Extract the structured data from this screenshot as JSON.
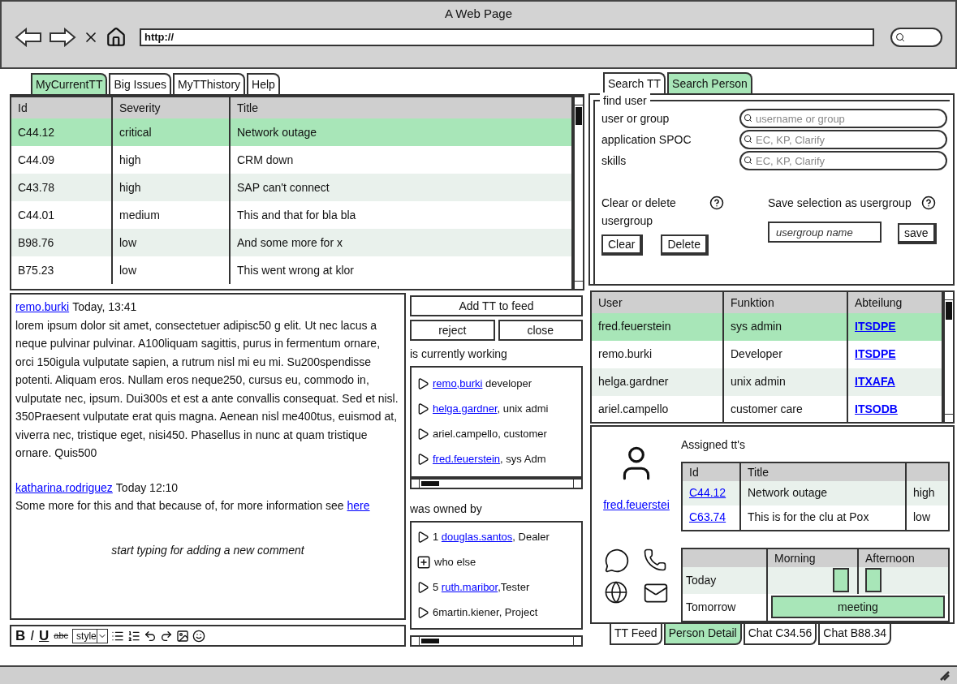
{
  "window": {
    "title": "A Web Page",
    "url": "http://"
  },
  "left_tabs": [
    {
      "label": "MyCurrentTT",
      "selected": true
    },
    {
      "label": "Big Issues",
      "selected": false
    },
    {
      "label": "MyTThistory",
      "selected": false
    },
    {
      "label": "Help",
      "selected": false
    }
  ],
  "tickets": {
    "columns": [
      "Id",
      "Severity",
      "Title"
    ],
    "rows": [
      {
        "cells": [
          "C44.12",
          "critical",
          "Network outage"
        ],
        "selected": true
      },
      {
        "cells": [
          "C44.09",
          "high",
          "CRM down"
        ],
        "selected": false
      },
      {
        "cells": [
          "C43.78",
          "high",
          "SAP can't connect"
        ],
        "selected": false
      },
      {
        "cells": [
          "C44.01",
          "medium",
          "This and that for bla bla"
        ],
        "selected": false
      },
      {
        "cells": [
          "B98.76",
          "low",
          "And some more for x"
        ],
        "selected": false
      },
      {
        "cells": [
          "B75.23",
          "low",
          "This went wrong at klor"
        ],
        "selected": false
      }
    ]
  },
  "feed": {
    "posts": [
      {
        "author": "remo.burki",
        "time": "Today, 13:41",
        "body": "lorem ipsum dolor sit amet, consectetuer adipisc50 g elit. Ut nec lacus a neque pulvinar pulvinar. A100liquam sagittis, purus in fermentum ornare, orci 150igula vulputate sapien, a rutrum nisl mi eu mi. Su200spendisse potenti. Aliquam eros. Nullam eros neque250, cursus eu, commodo in, vulputate nec, ipsum. Dui300s et est a ante convallis consequat. Sed et nisl. 350Praesent vulputate erat quis magna. Aenean nisl me400tus, euismod at, viverra nec, tristique eget, nisi450. Phasellus in nunc at quam tristique ornare. Quis500"
      },
      {
        "author": "katharina.rodriguez",
        "time": "Today 12:10",
        "body": "Some more for this and that because of, for more information see ",
        "link": "here"
      }
    ],
    "compose_placeholder": "start typing for adding a new comment",
    "toolbar": [
      {
        "kind": "bold",
        "label": "B"
      },
      {
        "kind": "italic",
        "label": "I"
      },
      {
        "kind": "underline",
        "label": "U"
      },
      {
        "kind": "strike",
        "label": "abc"
      },
      {
        "kind": "select",
        "label": "style"
      }
    ]
  },
  "actions": {
    "add": "Add TT to feed",
    "buttons": [
      "reject",
      "close"
    ]
  },
  "working": {
    "label": "is currently working",
    "items": [
      {
        "link": "remo,burki",
        "text": " developer"
      },
      {
        "link": "helga.gardner",
        "text": ", unix admi"
      },
      {
        "text": "ariel.campello, customer"
      },
      {
        "link": "fred.feuerstein",
        "text": ", sys Adm"
      }
    ]
  },
  "owned": {
    "label": "was owned by",
    "items": [
      {
        "kind": "arrow",
        "prefix": "1 ",
        "link": "douglas.santos",
        "text": ", Dealer"
      },
      {
        "kind": "plus",
        "text": "who else"
      },
      {
        "kind": "arrow",
        "prefix": "5 ",
        "link": "ruth.maribor",
        "text": ",Tester"
      },
      {
        "kind": "arrow",
        "text": "6martin.kiener, Project"
      }
    ]
  },
  "right_tabs": [
    {
      "label": "Search TT",
      "selected": false
    },
    {
      "label": "Search Person",
      "selected": true
    }
  ],
  "find_user": {
    "legend": "find user",
    "fields": [
      {
        "label": "user or group",
        "placeholder": "username or group"
      },
      {
        "label": "application SPOC",
        "placeholder": "EC, KP, Clarify"
      },
      {
        "label": "skills",
        "placeholder": "EC, KP, Clarify"
      }
    ],
    "clear_label": "Clear or delete usergroup",
    "buttons": [
      "Clear",
      "Delete"
    ],
    "save_label": "Save selection as usergroup",
    "name_placeholder": "usergroup name",
    "save_button": "save"
  },
  "users": {
    "columns": [
      "User",
      "Funktion",
      "Abteilung"
    ],
    "rows": [
      {
        "cells": [
          "fred.feuerstein",
          "sys admin",
          "ITSDPE"
        ],
        "selected": true
      },
      {
        "cells": [
          "remo.burki",
          "Developer",
          "ITSDPE"
        ],
        "selected": false
      },
      {
        "cells": [
          "helga.gardner",
          "unix admin",
          "ITXAFA"
        ],
        "selected": false
      },
      {
        "cells": [
          "ariel.campello",
          "customer care",
          "ITSODB"
        ],
        "selected": false
      }
    ]
  },
  "person": {
    "name": "fred.feuerstei",
    "assigned_title": "Assigned tt's",
    "assigned": {
      "columns": [
        "Id",
        "Title"
      ],
      "rows": [
        {
          "id": "C44.12",
          "title": "Network outage",
          "severity": "high"
        },
        {
          "id": "C63.74",
          "title": "This is for the clu at Pox",
          "severity": "low"
        }
      ]
    },
    "schedule": {
      "columns": [
        "Morning",
        "Afternoon"
      ],
      "rows": [
        {
          "label": "Today",
          "morning_busy": true,
          "afternoon_busy": true
        },
        {
          "label": "Tomorrow",
          "event": "meeting"
        }
      ]
    }
  },
  "bottom_tabs": [
    {
      "label": "TT Feed",
      "selected": false
    },
    {
      "label": "Person Detail",
      "selected": true
    },
    {
      "label": "Chat C34.56",
      "selected": false
    },
    {
      "label": "Chat B88.34",
      "selected": false
    }
  ]
}
